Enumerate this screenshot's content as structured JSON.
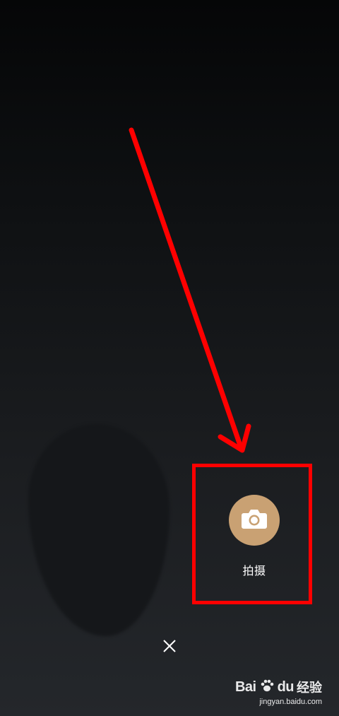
{
  "shoot": {
    "label": "拍摄",
    "icon": "camera-icon",
    "circle_color": "#c9a173"
  },
  "close": {
    "icon": "close-icon"
  },
  "annotation": {
    "color": "#ff0000"
  },
  "watermark": {
    "logo_text": "Bai",
    "logo_text2": "du",
    "cn_text": "经验",
    "url": "jingyan.baidu.com"
  }
}
